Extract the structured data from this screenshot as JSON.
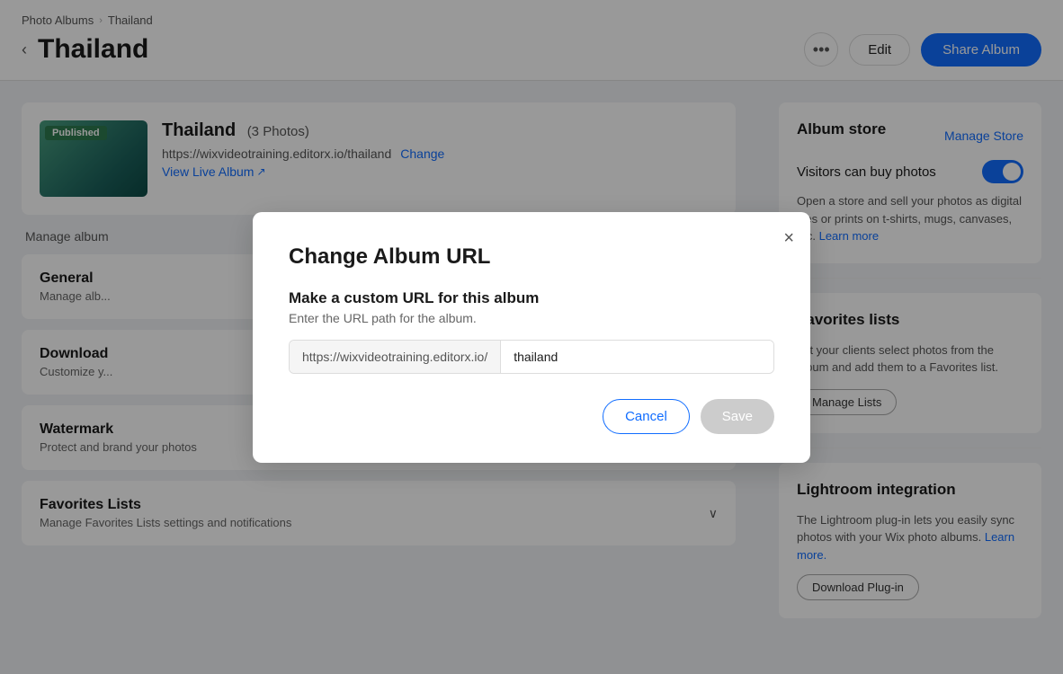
{
  "breadcrumb": {
    "parent": "Photo Albums",
    "current": "Thailand"
  },
  "header": {
    "back_label": "‹",
    "title": "Thailand",
    "dots_label": "•••",
    "edit_label": "Edit",
    "share_label": "Share Album"
  },
  "album": {
    "name": "Thailand",
    "count": "(3 Photos)",
    "url": "https://wixvideotraining.editorx.io/thailand",
    "change_label": "Change",
    "view_label": "View Live Album",
    "published_badge": "Published"
  },
  "manage_text": "Manage album",
  "sections": [
    {
      "title": "General",
      "subtitle": "Manage alb..."
    },
    {
      "title": "Download",
      "subtitle": "Customize y..."
    },
    {
      "title": "Watermark",
      "subtitle": "Protect and brand your photos"
    },
    {
      "title": "Favorites Lists",
      "subtitle": "Manage Favorites Lists settings and notifications"
    }
  ],
  "right": {
    "album_store": {
      "title": "Album store",
      "manage_label": "Manage Store",
      "visitors_label": "Visitors can buy photos",
      "description": "Open a store and sell your photos as digital files or prints on t-shirts, mugs, canvases, etc.",
      "learn_more": "Learn more"
    },
    "favorites": {
      "title": "Favorites lists",
      "description": "Let your clients select photos from the album and add them to a Favorites list.",
      "manage_label": "Manage Lists"
    },
    "lightroom": {
      "title": "Lightroom integration",
      "description": "The Lightroom plug-in lets you easily sync photos with your Wix photo albums.",
      "learn_more": "Learn more.",
      "download_label": "Download Plug-in"
    }
  },
  "modal": {
    "title": "Change Album URL",
    "subtitle": "Make a custom URL for this album",
    "description": "Enter the URL path for the album.",
    "url_prefix": "https://wixvideotraining.editorx.io/",
    "url_value": "thailand",
    "cancel_label": "Cancel",
    "save_label": "Save",
    "close_label": "×"
  }
}
